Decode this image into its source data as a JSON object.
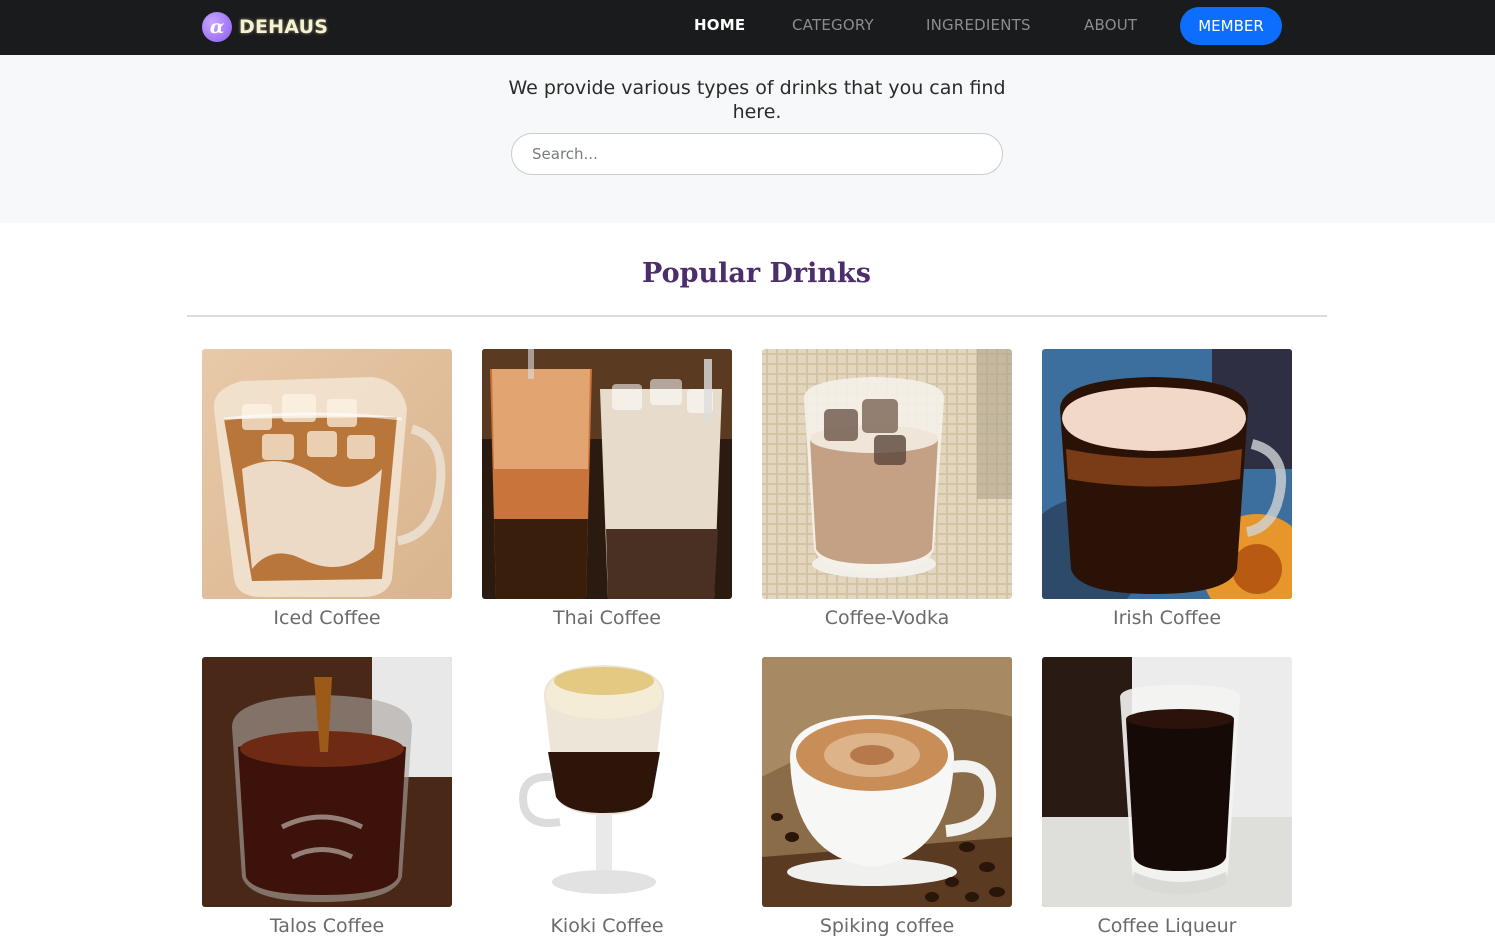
{
  "nav": {
    "brand": "DEHAUS",
    "logo_glyph": "α",
    "links": [
      {
        "label": "HOME",
        "active": true
      },
      {
        "label": "CATEGORY",
        "active": false
      },
      {
        "label": "INGREDIENTS",
        "active": false
      },
      {
        "label": "ABOUT",
        "active": false
      }
    ],
    "member_label": "MEMBER"
  },
  "hero": {
    "text": "We provide various types of drinks that you can find here.",
    "search_placeholder": "Search..."
  },
  "section": {
    "title": "Popular Drinks"
  },
  "drinks": [
    {
      "name": "Iced Coffee",
      "photo": "iced-coffee-photo"
    },
    {
      "name": "Thai Coffee",
      "photo": "thai-coffee-photo"
    },
    {
      "name": "Coffee-Vodka",
      "photo": "coffee-vodka-photo"
    },
    {
      "name": "Irish Coffee",
      "photo": "irish-coffee-photo"
    },
    {
      "name": "Talos Coffee",
      "photo": "talos-coffee-photo"
    },
    {
      "name": "Kioki Coffee",
      "photo": "kioki-coffee-photo"
    },
    {
      "name": "Spiking coffee",
      "photo": "spiking-coffee-photo"
    },
    {
      "name": "Coffee Liqueur",
      "photo": "coffee-liqueur-photo"
    }
  ],
  "colors": {
    "navbar_bg": "#1a1b1c",
    "member_button": "#0d6efd",
    "title_purple": "#4b2e6b",
    "hero_bg": "#f7f8f9"
  }
}
